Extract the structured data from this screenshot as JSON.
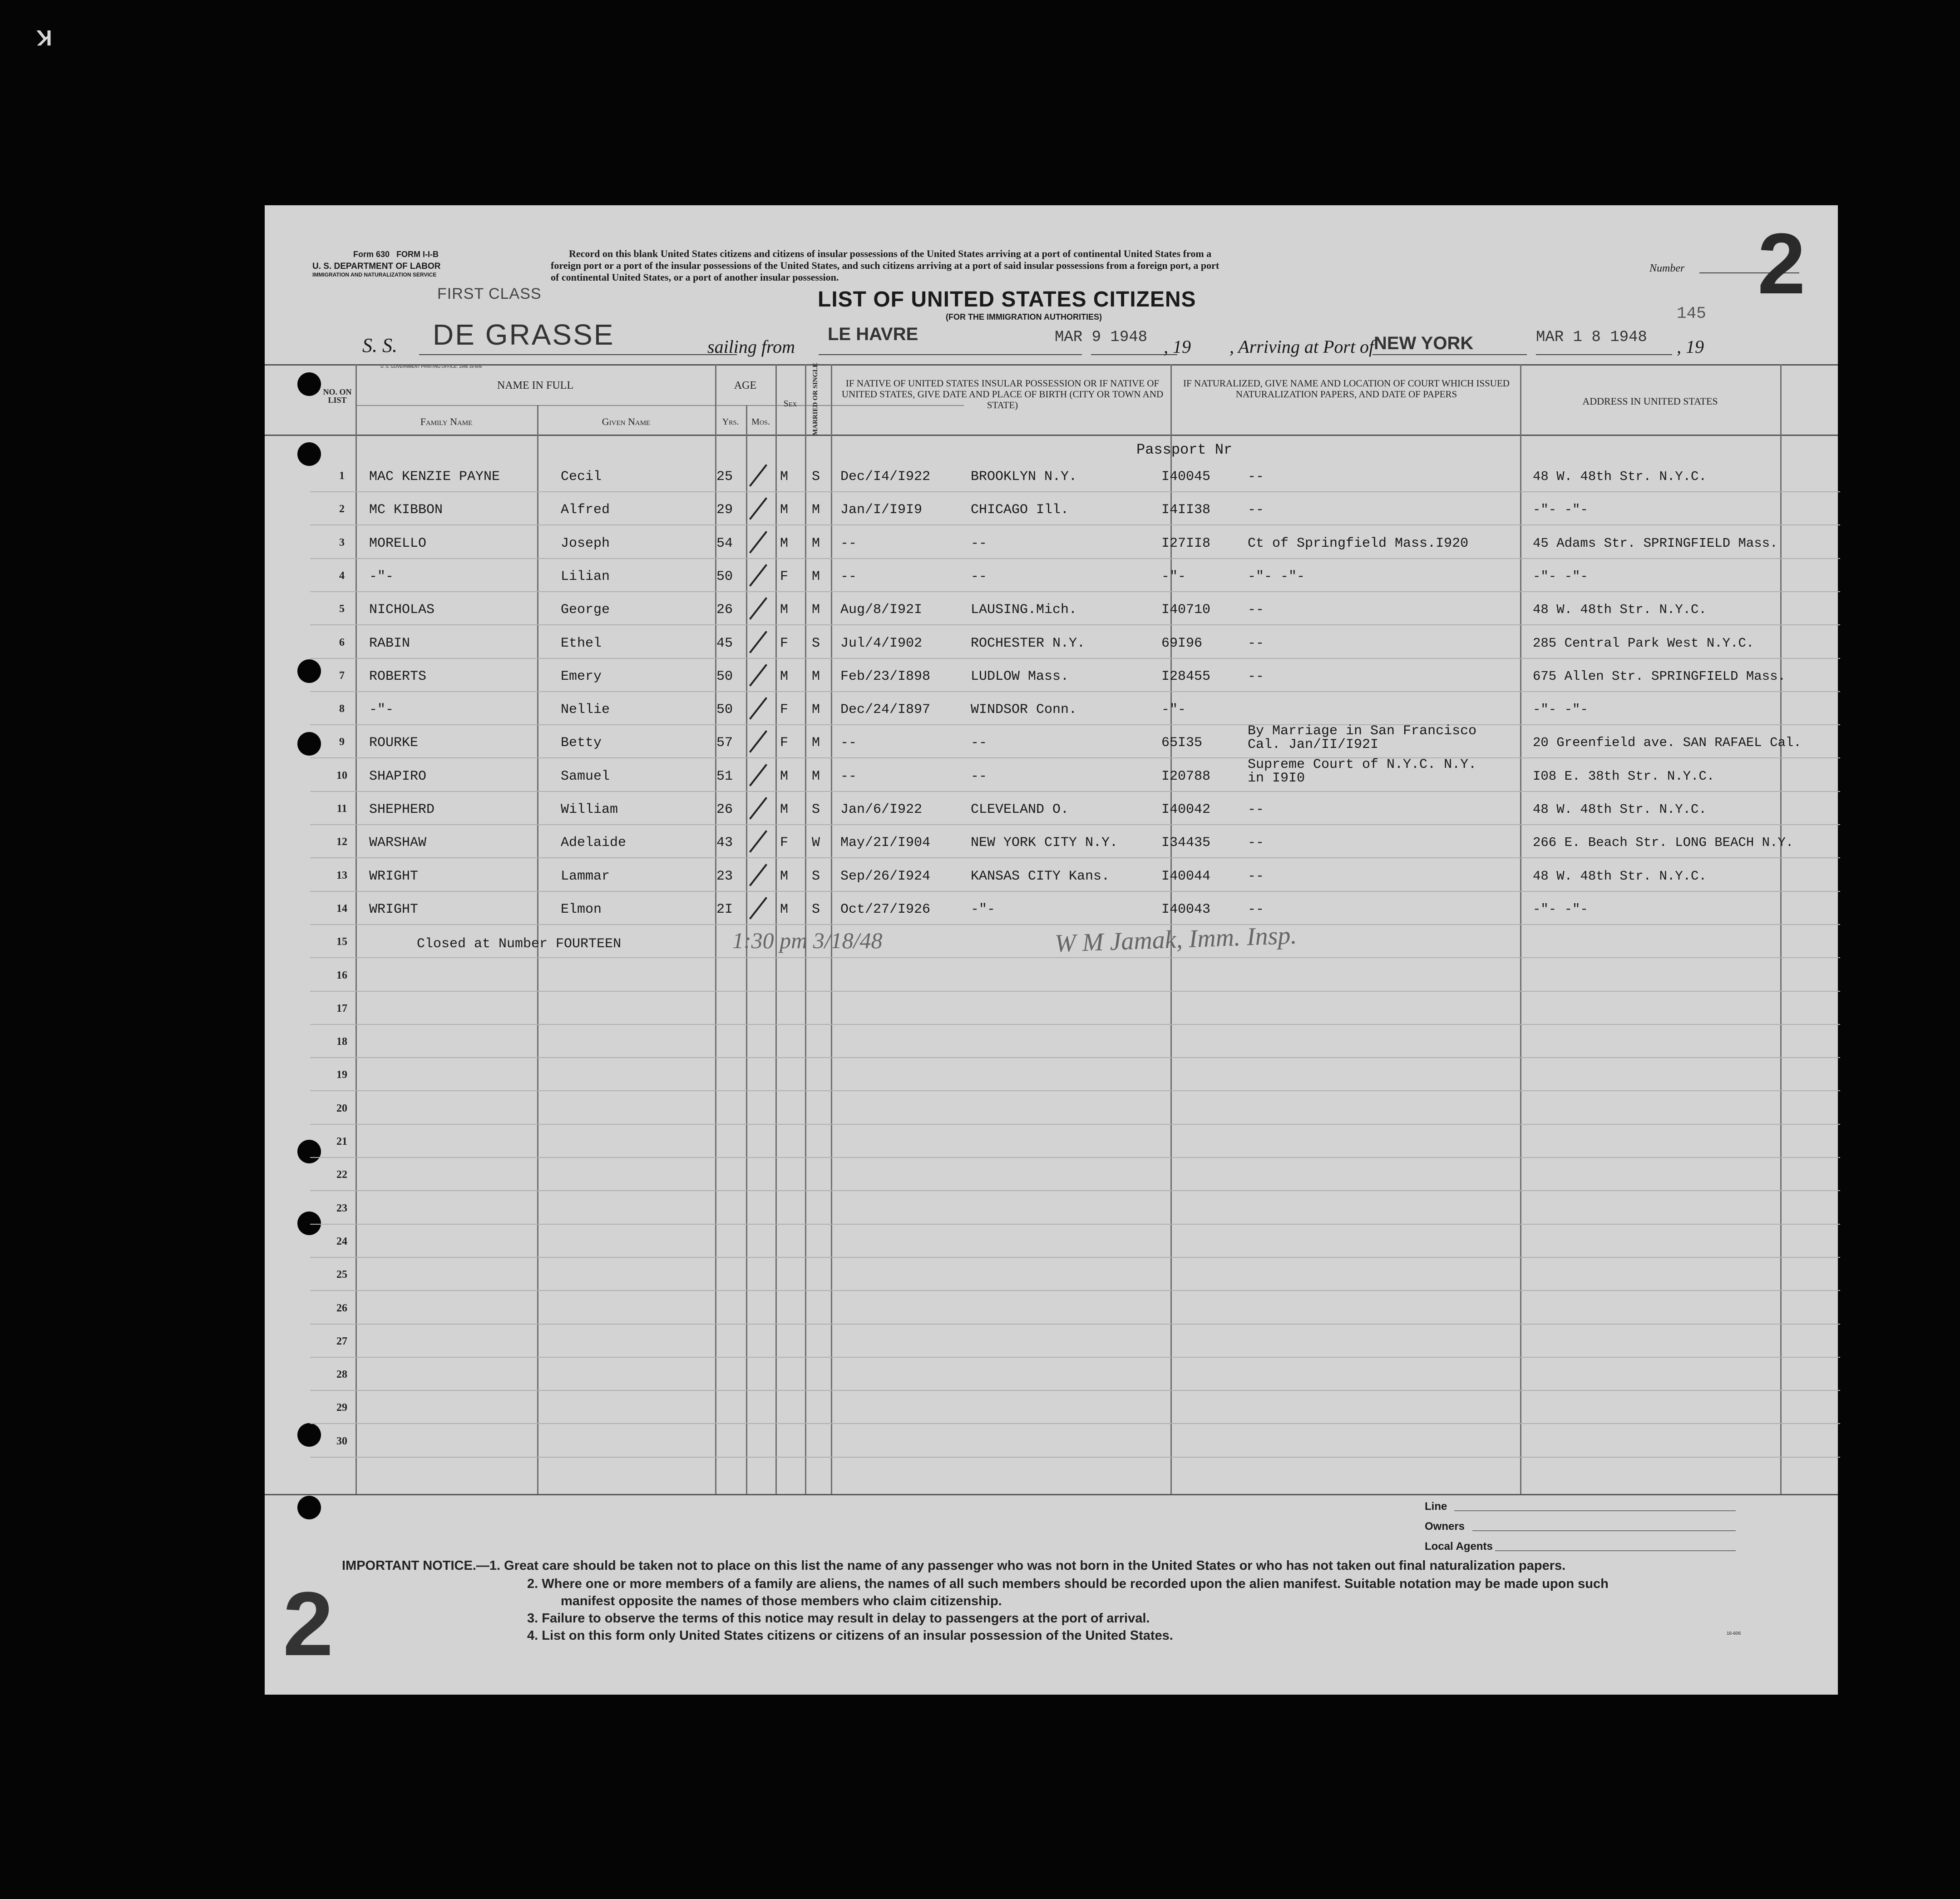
{
  "corner_mark": "K",
  "form": {
    "form_no": "Form 630",
    "form_ref": "FORM I-I-B",
    "department": "U. S. DEPARTMENT OF LABOR",
    "service": "IMMIGRATION AND NATURALIZATION SERVICE",
    "gpo": "U. S. GOVERNMENT PRINTING OFFICE: 1946    16-606",
    "instructions": [
      "Record on this blank United States citizens and citizens of insular possessions of the United States arriving at a port of continental United States from a",
      "foreign port or a port of the insular possessions of the United States, and such citizens arriving at a port of said insular possessions from a foreign port, a port",
      "of continental United States, or a port of another insular possession."
    ],
    "class": "FIRST CLASS",
    "title": "LIST OF UNITED STATES CITIZENS",
    "subtitle": "(FOR THE IMMIGRATION AUTHORITIES)",
    "number_label": "Number",
    "number": "2",
    "page_no": "145",
    "ss_label": "S. S.",
    "ship": "DE GRASSE",
    "sailing_label": "sailing from",
    "from_port": "LE HAVRE",
    "sail_date": "MAR  9 1948",
    "year_suffix": ", 19",
    "arriving_label": ", Arriving at Port of",
    "to_port": "NEW YORK",
    "arrive_date": "MAR 1 8 1948",
    "year_suffix2": ", 19"
  },
  "headers": {
    "no": "No. on List",
    "name_group": "NAME IN FULL",
    "family": "Family Name",
    "given": "Given Name",
    "age": "AGE",
    "yrs": "Yrs.",
    "mos": "Mos.",
    "sex": "Sex",
    "married": "Married or Single",
    "birth": "IF NATIVE OF UNITED STATES INSULAR POSSESSION OR IF NATIVE OF UNITED STATES, GIVE DATE AND PLACE OF BIRTH (CITY OR TOWN AND STATE)",
    "naturalized": "IF NATURALIZED, GIVE NAME AND LOCATION OF COURT WHICH ISSUED NATURALIZATION PAPERS, AND DATE OF PAPERS",
    "address": "ADDRESS IN UNITED STATES",
    "passport": "Passport Nr"
  },
  "rows": [
    {
      "family": "MAC KENZIE PAYNE",
      "given": "Cecil",
      "yrs": "25",
      "sex": "M",
      "ms": "S",
      "date": "Dec/I4/I922",
      "place": "BROOKLYN N.Y.",
      "passport": "I40045",
      "nat": "--",
      "addr": "48 W. 48th Str. N.Y.C."
    },
    {
      "family": "MC KIBBON",
      "given": "Alfred",
      "yrs": "29",
      "sex": "M",
      "ms": "M",
      "date": "Jan/I/I9I9",
      "place": "CHICAGO Ill.",
      "passport": "I4II38",
      "nat": "--",
      "addr": "-\"-           -\"-"
    },
    {
      "family": "MORELLO",
      "given": "Joseph",
      "yrs": "54",
      "sex": "M",
      "ms": "M",
      "date": "--",
      "place": "--",
      "passport": "I27II8",
      "nat": "Ct of Springfield Mass.I920",
      "addr": "45 Adams Str. SPRINGFIELD Mass."
    },
    {
      "family": "-\"-",
      "given": "Lilian",
      "yrs": "50",
      "sex": "F",
      "ms": "M",
      "date": "--",
      "place": "--",
      "passport": "-\"-",
      "nat": "-\"-        -\"-",
      "addr": "-\"-            -\"-"
    },
    {
      "family": "NICHOLAS",
      "given": "George",
      "yrs": "26",
      "sex": "M",
      "ms": "M",
      "date": "Aug/8/I92I",
      "place": "LAUSING.Mich.",
      "passport": "I40710",
      "nat": "--",
      "addr": "48 W. 48th Str.  N.Y.C."
    },
    {
      "family": "RABIN",
      "given": "Ethel",
      "yrs": "45",
      "sex": "F",
      "ms": "S",
      "date": "Jul/4/I902",
      "place": "ROCHESTER N.Y.",
      "passport": "69I96",
      "nat": "--",
      "addr": "285 Central Park West N.Y.C."
    },
    {
      "family": "ROBERTS",
      "given": "Emery",
      "yrs": "50",
      "sex": "M",
      "ms": "M",
      "date": "Feb/23/I898",
      "place": "LUDLOW Mass.",
      "passport": "I28455",
      "nat": "--",
      "addr": "675 Allen Str. SPRINGFIELD Mass."
    },
    {
      "family": "-\"-",
      "given": "Nellie",
      "yrs": "50",
      "sex": "F",
      "ms": "M",
      "date": "Dec/24/I897",
      "place": "WINDSOR Conn.",
      "passport": "-\"-",
      "nat": "",
      "addr": "-\"-            -\"-"
    },
    {
      "family": "ROURKE",
      "given": "Betty",
      "yrs": "57",
      "sex": "F",
      "ms": "M",
      "date": "--",
      "place": "--",
      "passport": "65I35",
      "nat": "By Marriage in San Francisco|Cal. Jan/II/I92I",
      "addr": "20 Greenfield ave. SAN RAFAEL Cal."
    },
    {
      "family": "SHAPIRO",
      "given": "Samuel",
      "yrs": "51",
      "sex": "M",
      "ms": "M",
      "date": "--",
      "place": "--",
      "passport": "I20788",
      "nat": "Supreme Court of N.Y.C. N.Y.|in I9I0",
      "addr": "I08 E. 38th Str.  N.Y.C."
    },
    {
      "family": "SHEPHERD",
      "given": "William",
      "yrs": "26",
      "sex": "M",
      "ms": "S",
      "date": "Jan/6/I922",
      "place": "CLEVELAND O.",
      "passport": "I40042",
      "nat": "--",
      "addr": "48 W. 48th Str. N.Y.C."
    },
    {
      "family": "WARSHAW",
      "given": "Adelaide",
      "yrs": "43",
      "sex": "F",
      "ms": "W",
      "date": "May/2I/I904",
      "place": "NEW YORK CITY N.Y.",
      "passport": "I34435",
      "nat": "--",
      "addr": "266 E. Beach Str. LONG BEACH N.Y."
    },
    {
      "family": "WRIGHT",
      "given": "Lammar",
      "yrs": "23",
      "sex": "M",
      "ms": "S",
      "date": "Sep/26/I924",
      "place": "KANSAS CITY Kans.",
      "passport": "I40044",
      "nat": "--",
      "addr": "48 W. 48th Str. N.Y.C."
    },
    {
      "family": "WRIGHT",
      "given": "Elmon",
      "yrs": "2I",
      "sex": "M",
      "ms": "S",
      "date": "Oct/27/I926",
      "place": "-\"-",
      "passport": "I40043",
      "nat": "--",
      "addr": "-\"-           -\"-"
    }
  ],
  "row_numbers": [
    "1",
    "2",
    "3",
    "4",
    "5",
    "6",
    "7",
    "8",
    "9",
    "10",
    "11",
    "12",
    "13",
    "14",
    "15",
    "16",
    "17",
    "18",
    "19",
    "20",
    "21",
    "22",
    "23",
    "24",
    "25",
    "26",
    "27",
    "28",
    "29",
    "30"
  ],
  "closing": {
    "text": "Closed at Number FOURTEEN",
    "time": "1:30 pm   3/18/48",
    "signature": "W M Jamak, Imm. Insp."
  },
  "footer": {
    "line": "Line",
    "owners": "Owners",
    "agents": "Local Agents",
    "notice_label": "IMPORTANT NOTICE.",
    "notices": [
      "—1.  Great care should be taken not to place on this list the name of any passenger who was not born in the United States or who has not taken out final naturalization papers.",
      "2.  Where one or more members of a family are aliens, the names of all such members should be recorded upon the alien manifest.  Suitable notation may be made upon such",
      "manifest opposite the names of those members who claim citizenship.",
      "3.  Failure to observe the terms of this notice may result in delay to passengers at the port of arrival.",
      "4.  List on this form only United States citizens or citizens of an insular possession of the United States."
    ],
    "big_number": "2",
    "small_ref": "16-606"
  }
}
